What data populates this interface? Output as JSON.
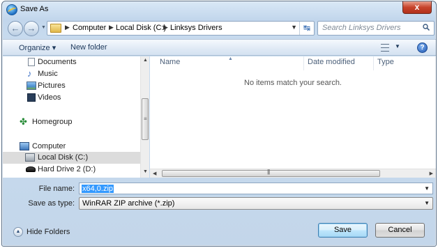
{
  "window": {
    "title": "Save As",
    "close_label": "x"
  },
  "address": {
    "breadcrumbs": [
      "Computer",
      "Local Disk (C:)",
      "Linksys Drivers"
    ]
  },
  "search": {
    "placeholder": "Search Linksys Drivers"
  },
  "toolbar": {
    "organize_label": "Organize ▾",
    "new_folder_label": "New folder",
    "help_label": "?"
  },
  "sidebar": {
    "items": [
      {
        "label": "Documents",
        "icon": "document-icon"
      },
      {
        "label": "Music",
        "icon": "music-icon"
      },
      {
        "label": "Pictures",
        "icon": "pictures-icon"
      },
      {
        "label": "Videos",
        "icon": "videos-icon"
      },
      {
        "label": "Homegroup",
        "icon": "homegroup-icon"
      },
      {
        "label": "Computer",
        "icon": "computer-icon"
      },
      {
        "label": "Local Disk (C:)",
        "icon": "local-disk-icon",
        "selected": true
      },
      {
        "label": "Hard Drive 2 (D:)",
        "icon": "hard-drive-icon"
      }
    ]
  },
  "file_list": {
    "columns": [
      "Name",
      "Date modified",
      "Type"
    ],
    "empty_message": "No items match your search."
  },
  "form": {
    "file_name_label": "File name:",
    "file_name_value": "x64,0.zip",
    "save_type_label": "Save as type:",
    "save_type_value": "WinRAR ZIP archive (*.zip)"
  },
  "footer": {
    "hide_folders_label": "Hide Folders",
    "save_label": "Save",
    "cancel_label": "Cancel"
  },
  "colors": {
    "selection": "#3399ff",
    "nav_selected": "#dcdcdc",
    "chrome": "#c9dcef"
  }
}
